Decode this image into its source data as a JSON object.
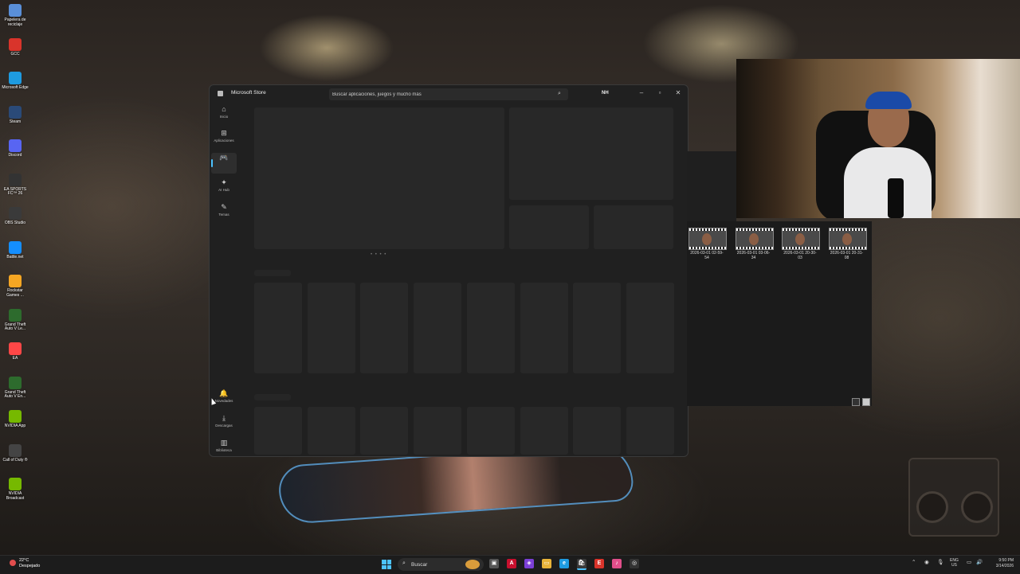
{
  "desktop": {
    "icons": [
      {
        "label": "Papelera de reciclaje",
        "icon": "recycle-bin-icon",
        "color": "#5a8fd8"
      },
      {
        "label": "GCC",
        "icon": "gcc-icon",
        "color": "#d9342b"
      },
      {
        "label": "Microsoft Edge",
        "icon": "edge-icon",
        "color": "#1e9be0"
      },
      {
        "label": "Steam",
        "icon": "steam-icon",
        "color": "#2a4a78"
      },
      {
        "label": "Discord",
        "icon": "discord-icon",
        "color": "#5865f2"
      },
      {
        "label": "EA SPORTS FC™ 26",
        "icon": "ea-fc-icon",
        "color": "#333333"
      },
      {
        "label": "OBS Studio",
        "icon": "obs-icon",
        "color": "#3a3a3a"
      },
      {
        "label": "Battle.net",
        "icon": "battlenet-icon",
        "color": "#148eff"
      },
      {
        "label": "Rockstar Games ...",
        "icon": "rockstar-icon",
        "color": "#f5a623"
      },
      {
        "label": "Grand Theft Auto V Le...",
        "icon": "gta-icon",
        "color": "#2d6b2d"
      },
      {
        "label": "EA",
        "icon": "ea-icon",
        "color": "#ff4747"
      },
      {
        "label": "Grand Theft Auto V En...",
        "icon": "gta-enhanced-icon",
        "color": "#2d6b2d"
      },
      {
        "label": "NVIDIA App",
        "icon": "nvidia-icon",
        "color": "#76b900"
      },
      {
        "label": "Call of Duty ®",
        "icon": "cod-icon",
        "color": "#444444"
      },
      {
        "label": "NVIDIA Broadcast",
        "icon": "nvidia-broadcast-icon",
        "color": "#76b900"
      }
    ]
  },
  "store": {
    "title": "Microsoft Store",
    "search_placeholder": "Buscar aplicaciones, juegos y mucho más",
    "user_initials": "NH",
    "nav_top": [
      {
        "label": "Inicio",
        "icon": "home-icon",
        "glyph": "⌂"
      },
      {
        "label": "Aplicaciones",
        "icon": "apps-icon",
        "glyph": "⊞"
      },
      {
        "label": "",
        "icon": "gaming-icon",
        "glyph": "🎮",
        "active": true
      },
      {
        "label": "AI Hub",
        "icon": "ai-hub-icon",
        "glyph": "✦"
      },
      {
        "label": "Temas",
        "icon": "themes-icon",
        "glyph": "✎"
      }
    ],
    "nav_bottom": [
      {
        "label": "Novedades",
        "icon": "bell-icon",
        "glyph": "🔔"
      },
      {
        "label": "Descargas",
        "icon": "downloads-icon",
        "glyph": "⤓"
      },
      {
        "label": "Biblioteca",
        "icon": "library-icon",
        "glyph": "▥"
      }
    ]
  },
  "recorder": {
    "clips": [
      {
        "label": "2026-03-01 02-59-54"
      },
      {
        "label": "2026-03-01 03-06-34"
      },
      {
        "label": "2026-03-01 20-30-03"
      },
      {
        "label": "2026-03-01 20-31-08"
      }
    ]
  },
  "taskbar": {
    "weather_temp": "22°C",
    "weather_desc": "Despejado",
    "search_placeholder": "Buscar",
    "lang_1": "ENG",
    "lang_2": "US",
    "time": "9:50 PM",
    "date": "3/14/2026"
  }
}
